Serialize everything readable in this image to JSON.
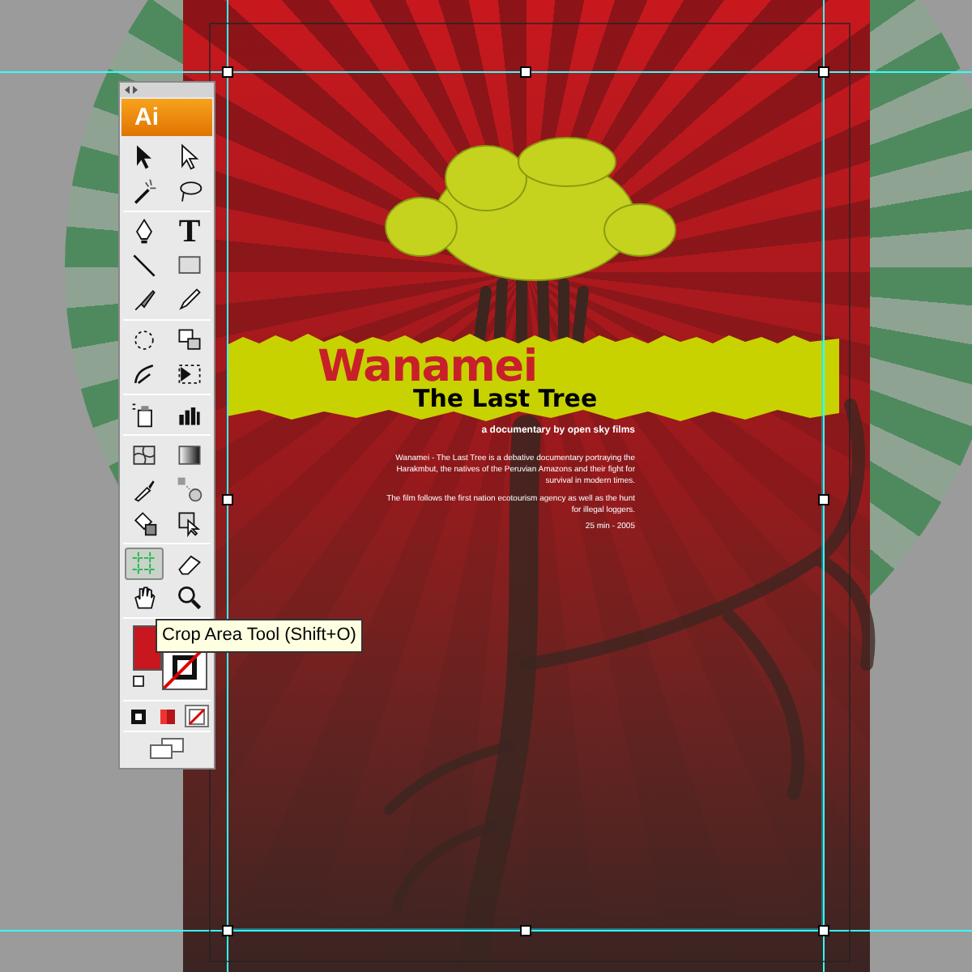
{
  "toolbar": {
    "logo": "Ai",
    "tool_groups": [
      [
        {
          "kind": "selection",
          "selected": false
        },
        {
          "kind": "direct-selection",
          "selected": false
        },
        {
          "kind": "magic-wand",
          "selected": false
        },
        {
          "kind": "lasso",
          "selected": false
        }
      ],
      [
        {
          "kind": "pen",
          "selected": false
        },
        {
          "kind": "type",
          "glyph": "T",
          "selected": false
        },
        {
          "kind": "line",
          "selected": false
        },
        {
          "kind": "rectangle",
          "selected": false
        },
        {
          "kind": "paintbrush",
          "selected": false
        },
        {
          "kind": "pencil",
          "selected": false
        }
      ],
      [
        {
          "kind": "rotate",
          "selected": false
        },
        {
          "kind": "scale",
          "selected": false
        },
        {
          "kind": "warp",
          "selected": false
        },
        {
          "kind": "free-transform",
          "selected": false
        }
      ],
      [
        {
          "kind": "symbol-sprayer",
          "selected": false
        },
        {
          "kind": "graph",
          "selected": false
        }
      ],
      [
        {
          "kind": "mesh",
          "selected": false
        },
        {
          "kind": "gradient",
          "selected": false
        },
        {
          "kind": "eyedropper",
          "selected": false
        },
        {
          "kind": "blend",
          "selected": false
        },
        {
          "kind": "live-paint",
          "selected": false
        },
        {
          "kind": "live-paint-selection",
          "selected": false
        }
      ],
      [
        {
          "kind": "crop-area",
          "selected": true
        },
        {
          "kind": "eraser",
          "selected": false
        },
        {
          "kind": "hand",
          "selected": false
        },
        {
          "kind": "zoom",
          "selected": false
        }
      ]
    ],
    "fill": {
      "color": "#c8171e"
    },
    "stroke": {
      "kind": "none"
    },
    "modes": [
      {
        "kind": "color",
        "selected": false
      },
      {
        "kind": "gradient",
        "selected": false
      },
      {
        "kind": "none",
        "selected": true
      }
    ]
  },
  "tooltip": "Crop Area Tool (Shift+O)",
  "poster": {
    "title": "Wanamei",
    "subtitle": "The Last Tree",
    "tagline": "a documentary by open sky films",
    "paragraphs": [
      "Wanamei - The Last Tree is a debative documentary portraying the Harakmbut, the natives of the Peruvian Amazons and their fight for survival in modern times.",
      "The film follows the first nation ecotourism agency as well as the hunt for illegal loggers."
    ],
    "footer": "25 min - 2005"
  }
}
